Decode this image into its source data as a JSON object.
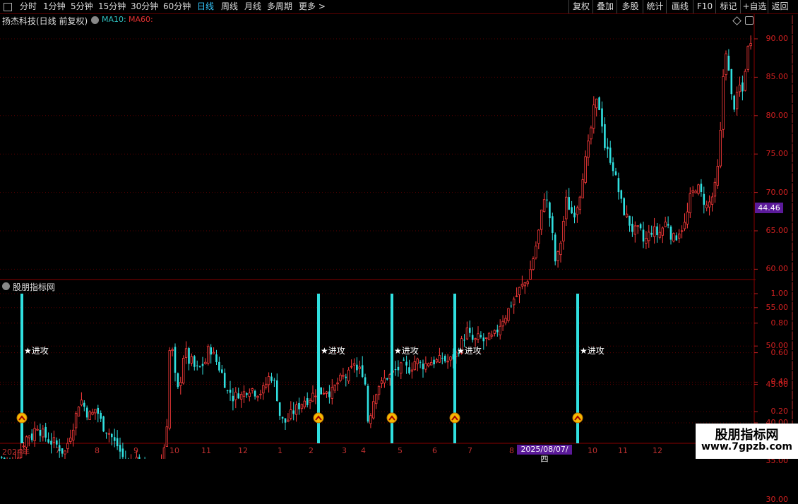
{
  "toolbar": {
    "period_tabs": [
      "分时",
      "1分钟",
      "5分钟",
      "15分钟",
      "30分钟",
      "60分钟",
      "日线",
      "周线",
      "月线",
      "多周期",
      "更多 >"
    ],
    "active_tab": "日线",
    "right_buttons": [
      "复权",
      "叠加",
      "多股",
      "统计",
      "画线",
      "F10",
      "标记",
      "+自选",
      "返回"
    ]
  },
  "main_chart": {
    "title": "扬杰科技(日线 前复权)",
    "ma_labels": [
      {
        "text": "MA10:",
        "color": "#30c0c0"
      },
      {
        "text": "MA60:",
        "color": "#e03030"
      }
    ],
    "y_ticks": [
      "90.00",
      "85.00",
      "80.00",
      "75.00",
      "70.00",
      "65.00",
      "60.00",
      "55.00",
      "50.00",
      "45.00",
      "40.00",
      "35.00",
      "30.00"
    ],
    "current_price": "44.46"
  },
  "sub_chart": {
    "title": "股朋指标网",
    "y_ticks": [
      "1.00",
      "0.80",
      "0.60",
      "0.40",
      "0.20"
    ],
    "signal_label": "★进攻"
  },
  "time_axis": {
    "labels": [
      "2024年",
      "7",
      "8",
      "9",
      "10",
      "11",
      "12",
      "1",
      "2",
      "3",
      "4",
      "5",
      "6",
      "7",
      "8",
      "10",
      "11",
      "12"
    ],
    "cursor_date": "2025/08/07/四"
  },
  "watermark": {
    "title": "股朋指标网",
    "url": "www.7gpzb.com"
  },
  "colors": {
    "up": "#ff3b3b",
    "down": "#30e0e0",
    "signal": "#30e0e0",
    "axis": "#c02020",
    "grid": "#5a0000"
  },
  "chart_data": {
    "type": "candlestick",
    "price_range": [
      30,
      92
    ],
    "signal_range": [
      0,
      1.05
    ],
    "close_path": [
      [
        0,
        35.5
      ],
      [
        10,
        35
      ],
      [
        15,
        34.2
      ],
      [
        20,
        35.6
      ],
      [
        25,
        36
      ],
      [
        30,
        37
      ],
      [
        35,
        38
      ],
      [
        40,
        38.5
      ],
      [
        45,
        38
      ],
      [
        50,
        40
      ],
      [
        55,
        39
      ],
      [
        60,
        38.5
      ],
      [
        65,
        38
      ],
      [
        70,
        37.5
      ],
      [
        75,
        37.5
      ],
      [
        80,
        37
      ],
      [
        85,
        36.5
      ],
      [
        90,
        36
      ],
      [
        95,
        37.5
      ],
      [
        100,
        39
      ],
      [
        105,
        40.5
      ],
      [
        110,
        42.5
      ],
      [
        115,
        43
      ],
      [
        120,
        41.5
      ],
      [
        125,
        41
      ],
      [
        130,
        41.2
      ],
      [
        135,
        42
      ],
      [
        140,
        40.5
      ],
      [
        145,
        39.5
      ],
      [
        150,
        39
      ],
      [
        155,
        38.5
      ],
      [
        160,
        37.5
      ],
      [
        165,
        37
      ],
      [
        170,
        36
      ],
      [
        175,
        35
      ],
      [
        180,
        34
      ],
      [
        185,
        35
      ],
      [
        190,
        35.5
      ],
      [
        195,
        35
      ],
      [
        200,
        34.5
      ],
      [
        205,
        34.5
      ],
      [
        210,
        34
      ],
      [
        215,
        33.5
      ],
      [
        220,
        33.2
      ],
      [
        225,
        34
      ],
      [
        230,
        36
      ],
      [
        235,
        40
      ],
      [
        240,
        52
      ],
      [
        245,
        47
      ],
      [
        250,
        44
      ],
      [
        255,
        46
      ],
      [
        260,
        50
      ],
      [
        265,
        48
      ],
      [
        270,
        48
      ],
      [
        275,
        47
      ],
      [
        280,
        47
      ],
      [
        285,
        47.5
      ],
      [
        290,
        48
      ],
      [
        295,
        50
      ],
      [
        300,
        49
      ],
      [
        305,
        48
      ],
      [
        310,
        47
      ],
      [
        315,
        46
      ],
      [
        320,
        44
      ],
      [
        325,
        44
      ],
      [
        330,
        43
      ],
      [
        335,
        44
      ],
      [
        340,
        43.5
      ],
      [
        345,
        44
      ],
      [
        350,
        44.5
      ],
      [
        355,
        44.5
      ],
      [
        360,
        44
      ],
      [
        365,
        44
      ],
      [
        370,
        44
      ],
      [
        375,
        45
      ],
      [
        380,
        46
      ],
      [
        385,
        46
      ],
      [
        390,
        44
      ],
      [
        395,
        41
      ],
      [
        400,
        40
      ],
      [
        405,
        40.2
      ],
      [
        410,
        41
      ],
      [
        415,
        41.5
      ],
      [
        420,
        42
      ],
      [
        425,
        42.5
      ],
      [
        430,
        43
      ],
      [
        435,
        43
      ],
      [
        440,
        43.5
      ],
      [
        445,
        44
      ],
      [
        450,
        44
      ],
      [
        455,
        44
      ],
      [
        460,
        44.5
      ],
      [
        465,
        44
      ],
      [
        470,
        44
      ],
      [
        475,
        45
      ],
      [
        480,
        45.5
      ],
      [
        485,
        46
      ],
      [
        490,
        46
      ],
      [
        495,
        46.5
      ],
      [
        500,
        48
      ],
      [
        505,
        46.5
      ],
      [
        510,
        47
      ],
      [
        515,
        46
      ],
      [
        520,
        40
      ],
      [
        525,
        42
      ],
      [
        530,
        44
      ],
      [
        535,
        45
      ],
      [
        540,
        45
      ],
      [
        545,
        46
      ],
      [
        550,
        46
      ],
      [
        555,
        46.5
      ],
      [
        560,
        47
      ],
      [
        565,
        47
      ],
      [
        570,
        47.5
      ],
      [
        575,
        47
      ],
      [
        580,
        47
      ],
      [
        585,
        48
      ],
      [
        590,
        48
      ],
      [
        595,
        47.5
      ],
      [
        600,
        47.5
      ],
      [
        605,
        48
      ],
      [
        610,
        48
      ],
      [
        615,
        48
      ],
      [
        620,
        48
      ],
      [
        625,
        48.5
      ],
      [
        630,
        48
      ],
      [
        635,
        48
      ],
      [
        640,
        48.5
      ],
      [
        645,
        49
      ],
      [
        650,
        50
      ],
      [
        655,
        51
      ],
      [
        660,
        52
      ],
      [
        665,
        51
      ],
      [
        670,
        50.5
      ],
      [
        675,
        51
      ],
      [
        680,
        51
      ],
      [
        685,
        50.5
      ],
      [
        690,
        51
      ],
      [
        695,
        51
      ],
      [
        700,
        51.5
      ],
      [
        705,
        52.5
      ],
      [
        710,
        53.5
      ],
      [
        715,
        54
      ],
      [
        720,
        55
      ],
      [
        725,
        56
      ],
      [
        730,
        56.5
      ],
      [
        735,
        57.5
      ],
      [
        740,
        58
      ],
      [
        745,
        58.5
      ],
      [
        750,
        60
      ],
      [
        755,
        62
      ],
      [
        760,
        64
      ],
      [
        765,
        67
      ],
      [
        770,
        70
      ],
      [
        775,
        68
      ],
      [
        780,
        65
      ],
      [
        785,
        61
      ],
      [
        790,
        62
      ],
      [
        795,
        65
      ],
      [
        800,
        69
      ],
      [
        805,
        68
      ],
      [
        810,
        67
      ],
      [
        815,
        68
      ],
      [
        820,
        70
      ],
      [
        825,
        73
      ],
      [
        830,
        75
      ],
      [
        835,
        78
      ],
      [
        840,
        81
      ],
      [
        845,
        82
      ],
      [
        850,
        80
      ],
      [
        855,
        76
      ],
      [
        860,
        75
      ],
      [
        865,
        74
      ],
      [
        870,
        72
      ],
      [
        875,
        70
      ],
      [
        880,
        68
      ],
      [
        885,
        67
      ],
      [
        890,
        66
      ],
      [
        895,
        65
      ],
      [
        900,
        65
      ],
      [
        905,
        65
      ],
      [
        910,
        63.5
      ],
      [
        915,
        64
      ],
      [
        920,
        65
      ],
      [
        925,
        65
      ],
      [
        930,
        64.5
      ],
      [
        935,
        65
      ],
      [
        940,
        66
      ],
      [
        945,
        66
      ],
      [
        950,
        64
      ],
      [
        955,
        64
      ],
      [
        960,
        65
      ],
      [
        965,
        65.5
      ],
      [
        970,
        66
      ],
      [
        975,
        69
      ],
      [
        980,
        70
      ],
      [
        985,
        71
      ],
      [
        990,
        70
      ],
      [
        995,
        69
      ],
      [
        1000,
        68
      ],
      [
        1005,
        69
      ],
      [
        1010,
        70
      ],
      [
        1015,
        73
      ],
      [
        1020,
        79
      ],
      [
        1025,
        90
      ],
      [
        1030,
        86
      ],
      [
        1035,
        82
      ],
      [
        1040,
        81
      ],
      [
        1045,
        84
      ],
      [
        1050,
        83
      ],
      [
        1055,
        87
      ],
      [
        1060,
        90
      ]
    ],
    "signals": [
      {
        "x": 31,
        "value": 1
      },
      {
        "x": 451,
        "value": 1
      },
      {
        "x": 555,
        "value": 1
      },
      {
        "x": 644,
        "value": 1
      },
      {
        "x": 818,
        "value": 1
      }
    ]
  }
}
